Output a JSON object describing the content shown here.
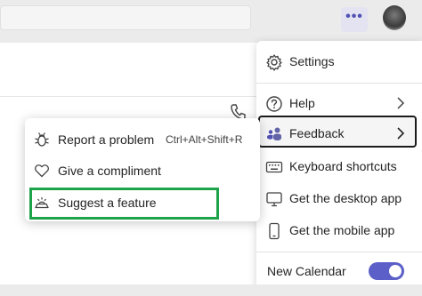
{
  "topbar": {
    "more_label": "•••"
  },
  "main_menu": {
    "settings": "Settings",
    "help": "Help",
    "feedback": "Feedback",
    "keyboard_shortcuts": "Keyboard shortcuts",
    "desktop_app": "Get the desktop app",
    "mobile_app": "Get the mobile app",
    "new_calendar": "New Calendar",
    "new_calendar_enabled": true
  },
  "feedback_submenu": {
    "report_problem": "Report a problem",
    "report_shortcut": "Ctrl+Alt+Shift+R",
    "compliment": "Give a compliment",
    "suggest_feature": "Suggest a feature"
  },
  "colors": {
    "accent": "#5b5fc7",
    "highlight": "#1fa34a"
  },
  "icons": {
    "settings": "gear-icon",
    "help": "help-circle-icon",
    "feedback": "feedback-icon",
    "keyboard": "keyboard-icon",
    "desktop": "desktop-icon",
    "mobile": "mobile-icon",
    "report": "bug-icon",
    "compliment": "heart-icon",
    "suggest": "lightbulb-icon",
    "call": "phone-icon"
  }
}
